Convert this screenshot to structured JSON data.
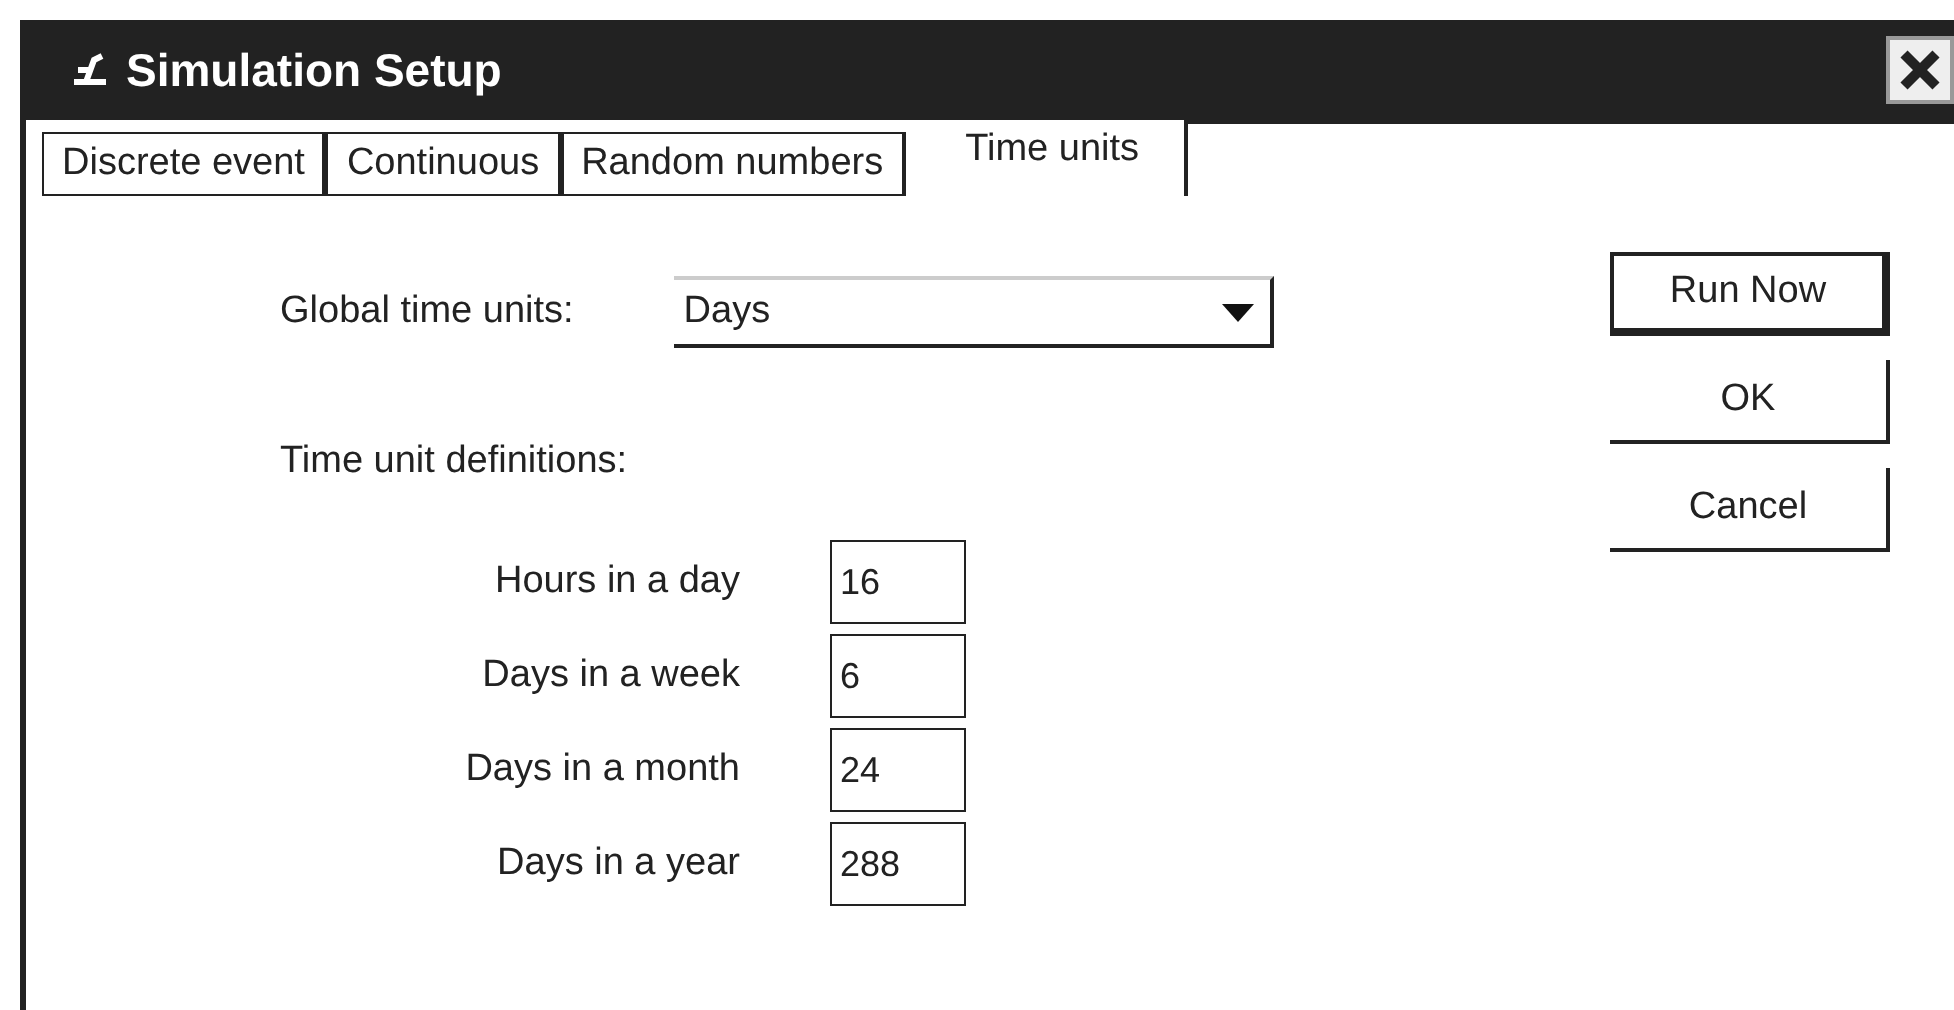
{
  "window": {
    "title": "Simulation Setup"
  },
  "tabs": [
    {
      "label": "Discrete event",
      "selected": false
    },
    {
      "label": "Continuous",
      "selected": false
    },
    {
      "label": "Random numbers",
      "selected": false
    },
    {
      "label": "Time units",
      "selected": true
    }
  ],
  "global_time_units": {
    "label": "Global time units:",
    "value": "Days"
  },
  "definitions_heading": "Time unit definitions:",
  "definitions": [
    {
      "label": "Hours in a day",
      "value": "16"
    },
    {
      "label": "Days in a week",
      "value": "6"
    },
    {
      "label": "Days in a month",
      "value": "24"
    },
    {
      "label": "Days in a year",
      "value": "288"
    }
  ],
  "buttons": [
    {
      "label": "Run Now",
      "default": true
    },
    {
      "label": "OK",
      "default": false
    },
    {
      "label": "Cancel",
      "default": false
    }
  ]
}
